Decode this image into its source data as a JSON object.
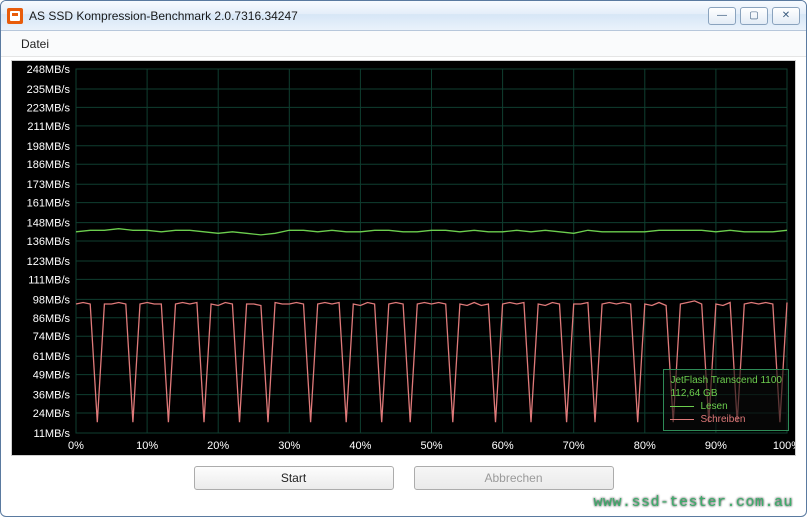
{
  "window": {
    "title": "AS SSD Kompression-Benchmark 2.0.7316.34247",
    "min": "—",
    "max": "▢",
    "close": "✕"
  },
  "menu": {
    "file": "Datei"
  },
  "legend": {
    "device": "JetFlash Transcend 1100",
    "capacity": "112,64 GB",
    "read": "Lesen",
    "write": "Schreiben"
  },
  "buttons": {
    "start": "Start",
    "cancel": "Abbrechen"
  },
  "watermark": "www.ssd-tester.com.au",
  "chart_data": {
    "type": "line",
    "xlabel": "",
    "ylabel": "",
    "x_ticks_pct": [
      0,
      10,
      20,
      30,
      40,
      50,
      60,
      70,
      80,
      90,
      100
    ],
    "y_ticks_mb_s": [
      11,
      24,
      36,
      49,
      61,
      74,
      86,
      98,
      111,
      123,
      136,
      148,
      161,
      173,
      186,
      198,
      211,
      223,
      235,
      248
    ],
    "ylim": [
      11,
      248
    ],
    "series": [
      {
        "name": "Lesen",
        "color": "#6cce4e",
        "x_pct": [
          0,
          2,
          4,
          6,
          8,
          10,
          12,
          14,
          16,
          18,
          20,
          22,
          24,
          26,
          28,
          30,
          32,
          34,
          36,
          38,
          40,
          42,
          44,
          46,
          48,
          50,
          52,
          54,
          56,
          58,
          60,
          62,
          64,
          66,
          68,
          70,
          72,
          74,
          76,
          78,
          80,
          82,
          84,
          86,
          88,
          90,
          92,
          94,
          96,
          98,
          100
        ],
        "y_mb_s": [
          142,
          143,
          143,
          144,
          143,
          143,
          142,
          143,
          143,
          142,
          141,
          142,
          141,
          140,
          141,
          143,
          143,
          142,
          143,
          142,
          142,
          143,
          143,
          142,
          142,
          143,
          143,
          142,
          143,
          142,
          142,
          143,
          142,
          143,
          142,
          141,
          143,
          142,
          142,
          142,
          142,
          143,
          143,
          143,
          143,
          142,
          143,
          142,
          142,
          142,
          143
        ]
      },
      {
        "name": "Schreiben",
        "color": "#e07a7a",
        "x_pct": [
          0,
          1,
          2,
          3,
          4,
          5,
          6,
          7,
          8,
          9,
          10,
          11,
          12,
          13,
          14,
          15,
          16,
          17,
          18,
          19,
          20,
          21,
          22,
          23,
          24,
          25,
          26,
          27,
          28,
          29,
          30,
          31,
          32,
          33,
          34,
          35,
          36,
          37,
          38,
          39,
          40,
          41,
          42,
          43,
          44,
          45,
          46,
          47,
          48,
          49,
          50,
          51,
          52,
          53,
          54,
          55,
          56,
          57,
          58,
          59,
          60,
          61,
          62,
          63,
          64,
          65,
          66,
          67,
          68,
          69,
          70,
          71,
          72,
          73,
          74,
          75,
          76,
          77,
          78,
          79,
          80,
          81,
          82,
          83,
          84,
          85,
          86,
          87,
          88,
          89,
          90,
          91,
          92,
          93,
          94,
          95,
          96,
          97,
          98,
          99,
          100
        ],
        "y_mb_s": [
          95,
          96,
          95,
          18,
          95,
          95,
          96,
          95,
          18,
          95,
          96,
          95,
          95,
          18,
          95,
          96,
          95,
          96,
          18,
          95,
          94,
          96,
          95,
          18,
          95,
          95,
          94,
          18,
          96,
          95,
          95,
          96,
          95,
          18,
          95,
          96,
          95,
          96,
          18,
          95,
          94,
          96,
          95,
          18,
          95,
          96,
          95,
          18,
          95,
          96,
          95,
          96,
          95,
          18,
          95,
          94,
          96,
          94,
          95,
          18,
          95,
          96,
          95,
          96,
          18,
          95,
          94,
          96,
          95,
          18,
          95,
          95,
          96,
          18,
          95,
          96,
          95,
          96,
          95,
          18,
          95,
          94,
          96,
          94,
          18,
          95,
          96,
          97,
          95,
          18,
          95,
          94,
          96,
          18,
          95,
          96,
          95,
          96,
          95,
          18,
          96
        ]
      }
    ]
  }
}
